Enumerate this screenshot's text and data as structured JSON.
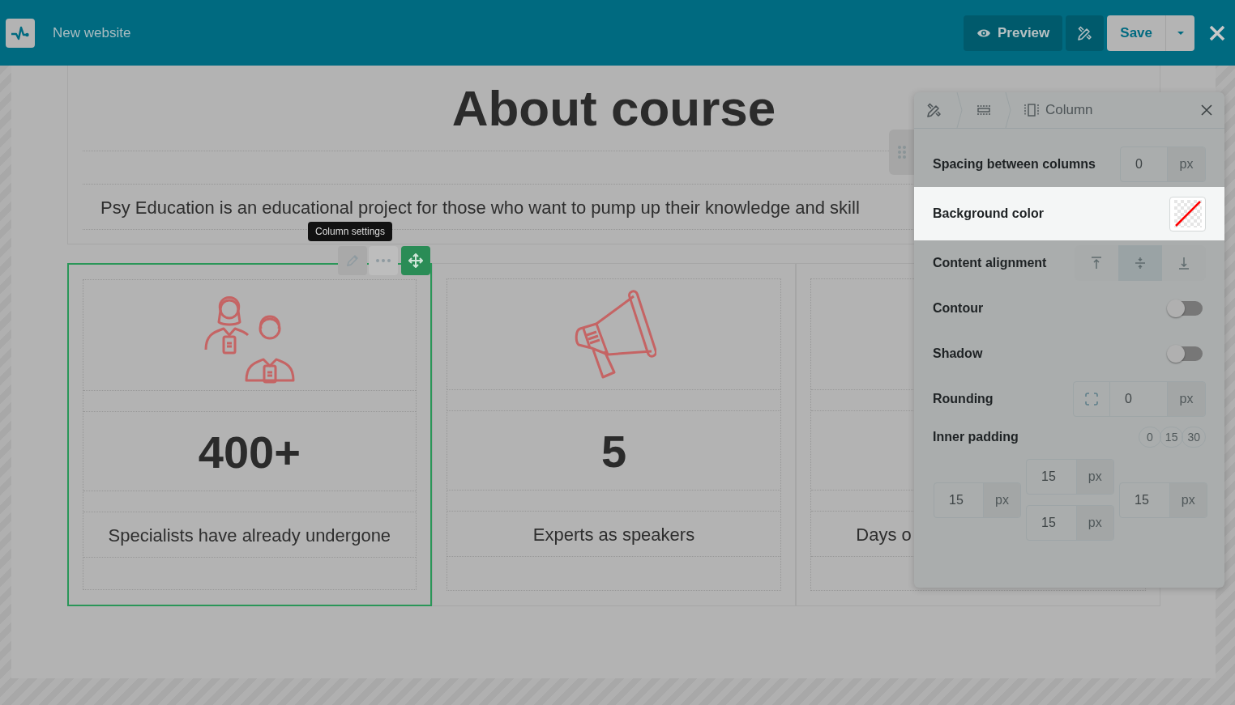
{
  "topbar": {
    "title": "New website",
    "preview": "Preview",
    "save": "Save"
  },
  "page": {
    "heading": "About course",
    "paragraph": "Psy Education is an educational project for those who want to pump up their knowledge and skill",
    "columns": [
      {
        "kind": "people",
        "value": "400+",
        "caption": "Specialists have already undergone",
        "selected": true
      },
      {
        "kind": "megaphone",
        "value": "5",
        "caption": "Experts as speakers",
        "selected": false
      },
      {
        "caption": "Days o",
        "selected": false
      }
    ]
  },
  "column_toolbar": {
    "tooltip": "Column settings"
  },
  "panel": {
    "title": "Column",
    "rows": [
      {
        "kind": "number",
        "label": "Spacing between columns",
        "value": "0",
        "unit": "px",
        "highlighted": false
      },
      {
        "kind": "color",
        "label": "Background color",
        "highlighted": true
      },
      {
        "kind": "align",
        "label": "Content alignment",
        "highlighted": false,
        "options": [
          {
            "selected": false
          },
          {
            "selected": true
          },
          {
            "selected": false
          }
        ]
      },
      {
        "kind": "toggle",
        "label": "Contour",
        "on": false,
        "highlighted": false
      },
      {
        "kind": "toggle",
        "label": "Shadow",
        "on": false,
        "highlighted": false
      },
      {
        "kind": "rounding",
        "label": "Rounding",
        "value": "0",
        "unit": "px",
        "highlighted": false
      },
      {
        "kind": "padding",
        "label": "Inner padding",
        "highlighted": false,
        "presets": [
          "0",
          "15",
          "30"
        ],
        "sides": [
          {
            "value": "15",
            "unit": "px"
          },
          {
            "value": "15",
            "unit": "px"
          },
          {
            "value": "15",
            "unit": "px"
          },
          {
            "value": "15",
            "unit": "px"
          }
        ]
      }
    ]
  }
}
